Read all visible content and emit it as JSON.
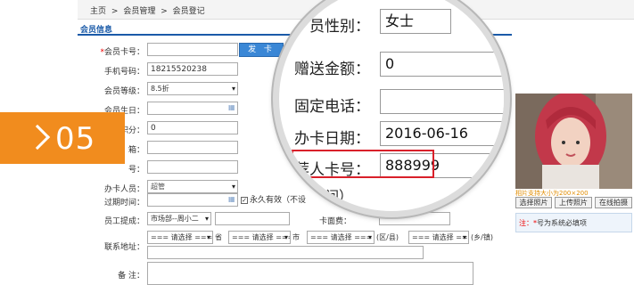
{
  "breadcrumb": {
    "home": "主页",
    "sep1": ">",
    "module": "会员管理",
    "sep2": ">",
    "page": "会员登记"
  },
  "section": {
    "title": "会员信息"
  },
  "form": {
    "card_no": {
      "label": "会员卡号：",
      "value": ""
    },
    "card_button": "发 卡",
    "phone": {
      "label": "手机号码：",
      "value": "18215520238"
    },
    "level": {
      "label": "会员等级：",
      "value": "8.5折"
    },
    "birthday": {
      "label": "会员生日：",
      "value": ""
    },
    "points": {
      "label": "积分：",
      "value": "0"
    },
    "row6": {
      "label": "箱：",
      "value": ""
    },
    "row7": {
      "label": "号：",
      "value": ""
    },
    "operator": {
      "label": "办卡人员：",
      "value": "超管"
    },
    "expire": {
      "label": "过期时间：",
      "value": ""
    },
    "permanent": {
      "check": "✓",
      "label": "永久有效（不设"
    },
    "staff_commission": {
      "label": "员工提成：",
      "value": "市场部--周小二"
    },
    "card_fee_label": "卡面费：",
    "address": {
      "label": "联系地址：",
      "province": "=== 请选择 ===",
      "province_unit": "省",
      "city": "=== 请选择 ===",
      "city_unit": "市",
      "district": "=== 请选择 ===",
      "district_unit": "(区/县)",
      "town": "=== 请选择 ===",
      "town_unit": "(乡/镇)"
    },
    "remark": {
      "label": "备 注："
    }
  },
  "photo": {
    "tip": "相片支持大小为200×200",
    "buttons": [
      "选择照片",
      "上传照片",
      "在线拍摄"
    ],
    "note_star": "注：*",
    "note_text": "号为系统必填项"
  },
  "badge": {
    "number": "05"
  },
  "magnifier": {
    "gender": {
      "label": "员性别：",
      "value": "女士"
    },
    "gift": {
      "label": "赠送金额：",
      "value": "0"
    },
    "landline": {
      "label": "固定电话：",
      "value": ""
    },
    "card_date": {
      "label": "办卡日期：",
      "value": "2016-06-16"
    },
    "referrer": {
      "label": "推荐人卡号：",
      "value": "888999"
    },
    "expire_hint": "期时间）"
  }
}
